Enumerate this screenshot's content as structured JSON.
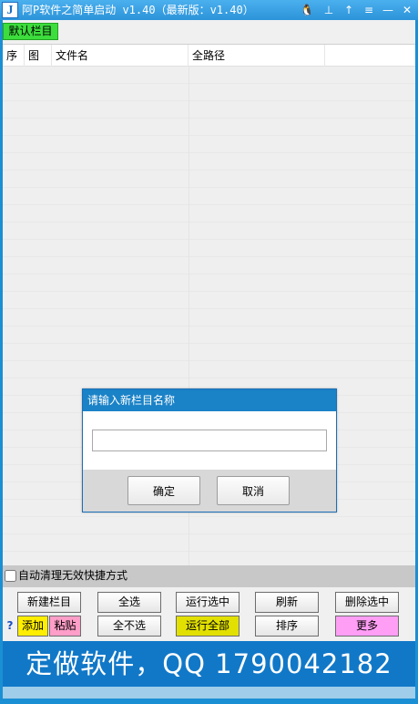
{
  "window": {
    "title": "阿P软件之简单启动 v1.40（最新版：v1.40）",
    "app_icon_letter": "J",
    "title_buttons": {
      "qq": "🐧",
      "dock": "⊥",
      "up": "↑",
      "menu": "≡",
      "minimize": "—",
      "close": "✕"
    }
  },
  "tabs": [
    {
      "label": "默认栏目",
      "active": true
    }
  ],
  "list": {
    "columns": [
      "序",
      "图",
      "文件名",
      "全路径",
      ""
    ]
  },
  "dialog": {
    "title": "请输入新栏目名称",
    "input_value": "",
    "ok_label": "确定",
    "cancel_label": "取消"
  },
  "options": {
    "auto_clean_label": "自动清理无效快捷方式",
    "auto_clean_checked": false
  },
  "buttons": {
    "new_column": "新建栏目",
    "select_all": "全选",
    "run_selected": "运行选中",
    "refresh": "刷新",
    "delete_selected": "删除选中",
    "help": "?",
    "add": "添加",
    "paste": "粘贴",
    "deselect_all": "全不选",
    "run_all": "运行全部",
    "sort": "排序",
    "more": "更多"
  },
  "banner": {
    "text": "定做软件，QQ 1790042182"
  },
  "colors": {
    "title_bar": "#2b93d9",
    "tab_active": "#3cdd3c",
    "banner": "#1178c8",
    "add_button": "#ffee00",
    "paste_button": "#ff9ec8",
    "run_all_button": "#e2e000",
    "more_button": "#ff9ef5"
  }
}
